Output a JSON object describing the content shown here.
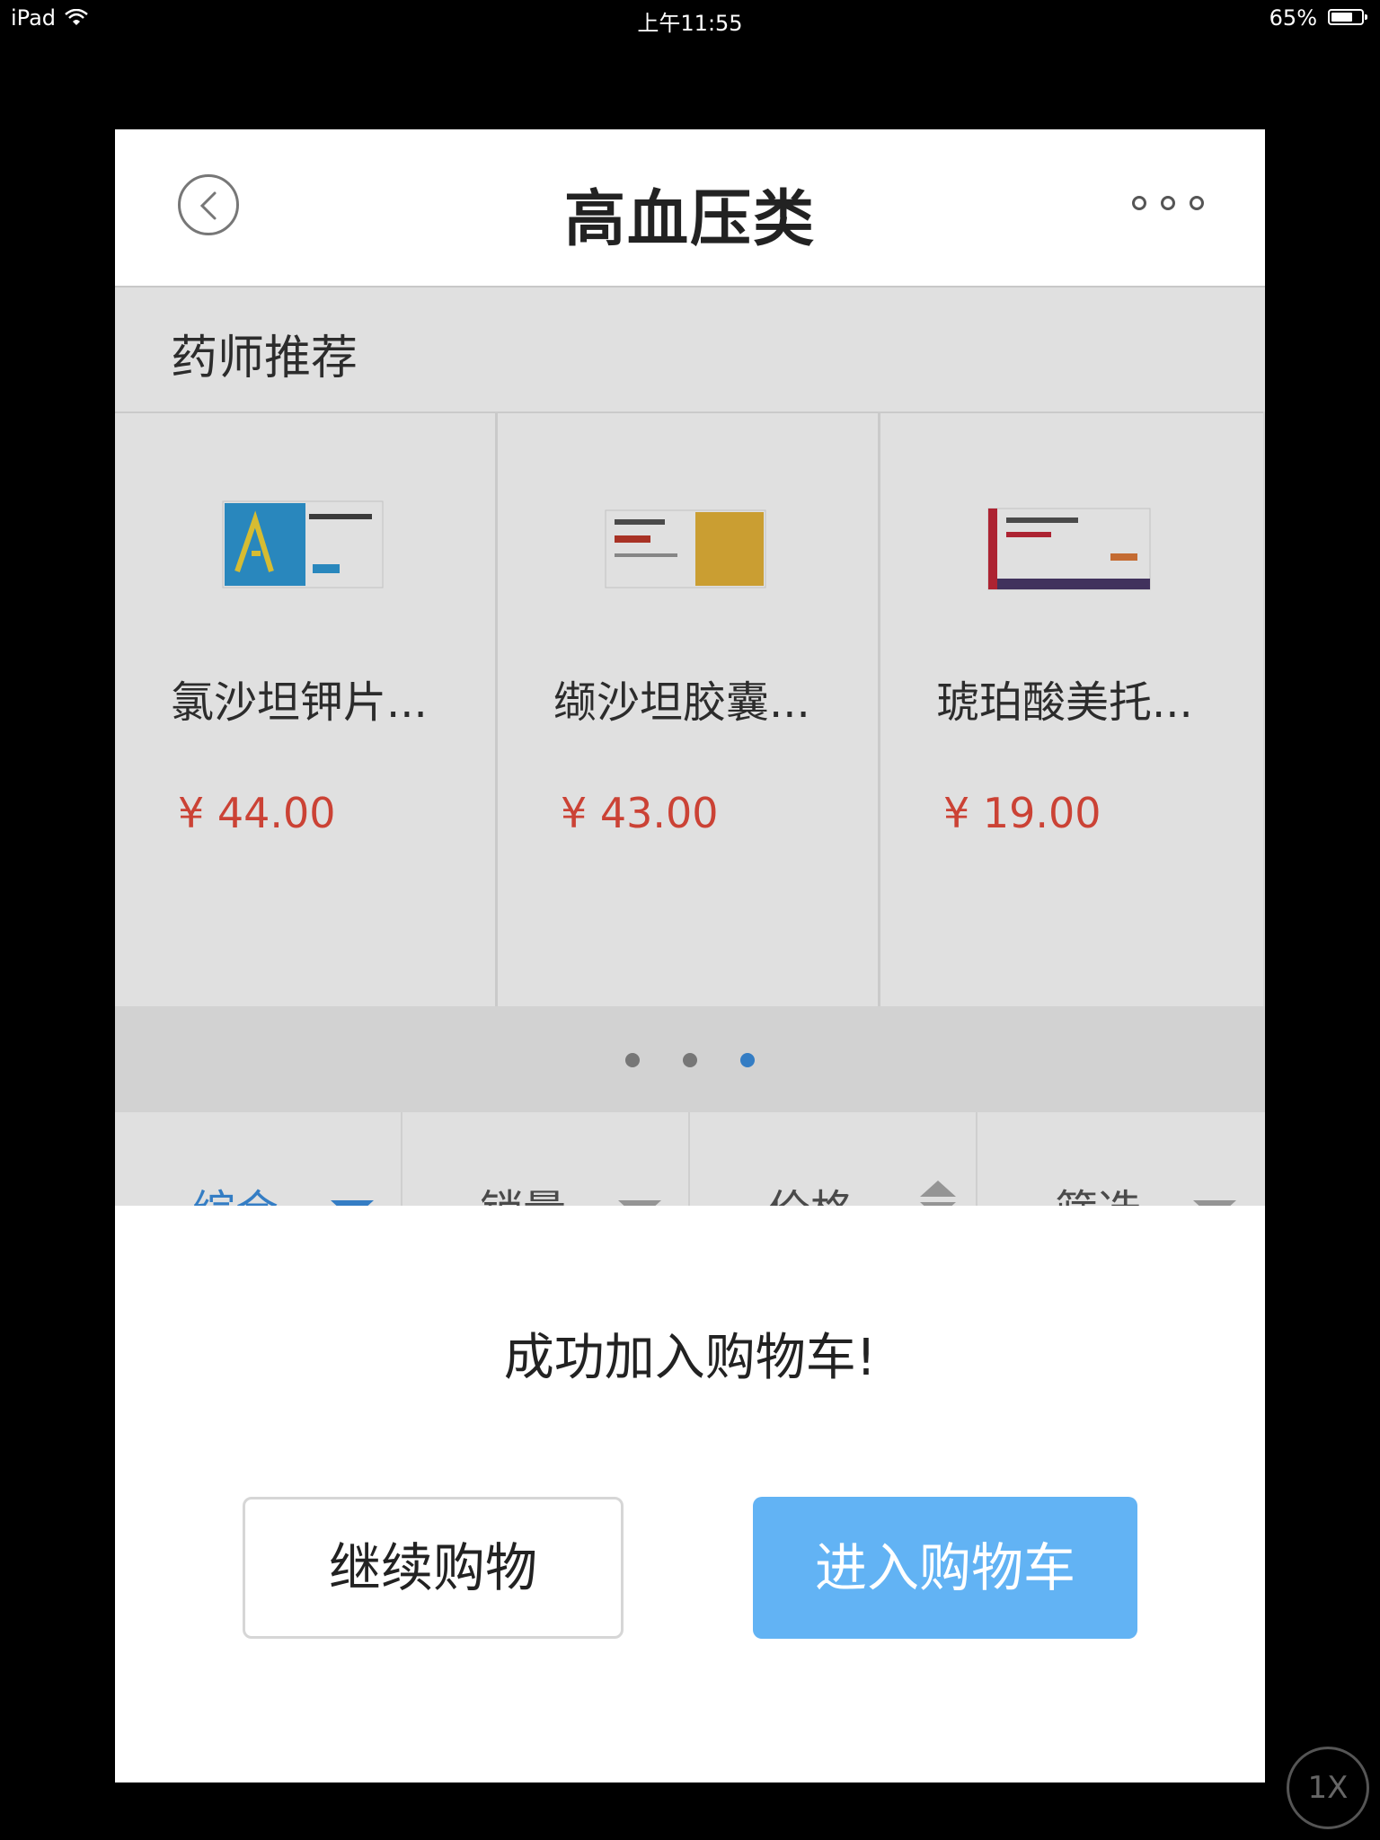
{
  "status_bar": {
    "device": "iPad",
    "time": "上午11:55",
    "battery": "65%",
    "battery_level": 0.65
  },
  "nav": {
    "title": "高血压类",
    "back_icon": "chevron-left-icon",
    "more_icon": "more-icon"
  },
  "recommend": {
    "title": "药师推荐",
    "products": [
      {
        "name": "氯沙坦钾片...",
        "price": "¥ 44.00",
        "box_color": "#2f9ad8"
      },
      {
        "name": "缬沙坦胶囊...",
        "price": "¥ 43.00",
        "box_color": "#e6b43a"
      },
      {
        "name": "琥珀酸美托...",
        "price": "¥ 19.00",
        "box_color": "#c5283a"
      }
    ],
    "carousel": {
      "pages": 3,
      "active": 3
    }
  },
  "filters": [
    {
      "label": "综合",
      "active": true
    },
    {
      "label": "销量",
      "active": false
    },
    {
      "label": "价格",
      "active": false
    },
    {
      "label": "筛选",
      "active": false
    }
  ],
  "dialog": {
    "message": "成功加入购物车!",
    "continue_label": "继续购物",
    "cart_label": "进入购物车"
  },
  "zoom": "1X",
  "colors": {
    "accent": "#3c8fe0",
    "price": "#e84c3d",
    "primary_button": "#62b3f4"
  }
}
